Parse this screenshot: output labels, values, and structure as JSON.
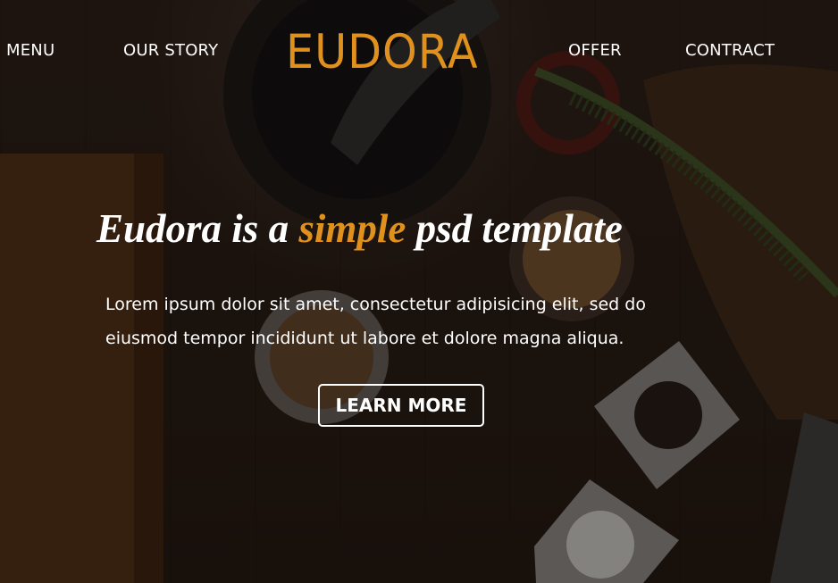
{
  "colors": {
    "accent": "#e0901c",
    "text": "#ffffff",
    "background": "#261a13"
  },
  "nav": {
    "menu": "MENU",
    "our_story": "OUR STORY",
    "offer": "OFFER",
    "contract": "CONTRACT"
  },
  "brand": {
    "logo": "EUDORA"
  },
  "hero": {
    "headline_start": "Eudora is a ",
    "headline_accent": "simple",
    "headline_end": " psd template",
    "body": "Lorem ipsum dolor sit amet, consectetur adipisicing elit, sed do eiusmod tempor incididunt ut labore et dolore magna aliqua.",
    "cta_label": "LEARN MORE"
  }
}
